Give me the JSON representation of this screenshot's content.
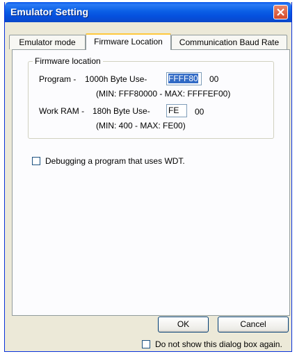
{
  "window": {
    "title": "Emulator Setting"
  },
  "tabs": [
    {
      "label": "Emulator mode",
      "active": false
    },
    {
      "label": "Firmware Location",
      "active": true
    },
    {
      "label": "Communication Baud Rate",
      "active": false
    }
  ],
  "firmware": {
    "group_title": "Firmware location",
    "program": {
      "label": "Program -",
      "size_label": "1000h Byte Use-",
      "value": "FFFF80",
      "suffix": "00",
      "range": "(MIN: FFF80000 - MAX: FFFFEF00)"
    },
    "work_ram": {
      "label": "Work RAM -",
      "size_label": "180h Byte Use-",
      "value": "FE",
      "suffix": "00",
      "range": "(MIN: 400 - MAX: FE00)"
    }
  },
  "wdt_checkbox": {
    "label": "Debugging a program that uses WDT.",
    "checked": false
  },
  "buttons": {
    "ok": "OK",
    "cancel": "Cancel"
  },
  "dont_show_checkbox": {
    "label": "Do not show this dialog box again.",
    "checked": false
  },
  "colors": {
    "titlebar": "#0a56ea",
    "close": "#d44a2a",
    "selection": "#316ac5",
    "tab_highlight": "#ffc83c"
  }
}
